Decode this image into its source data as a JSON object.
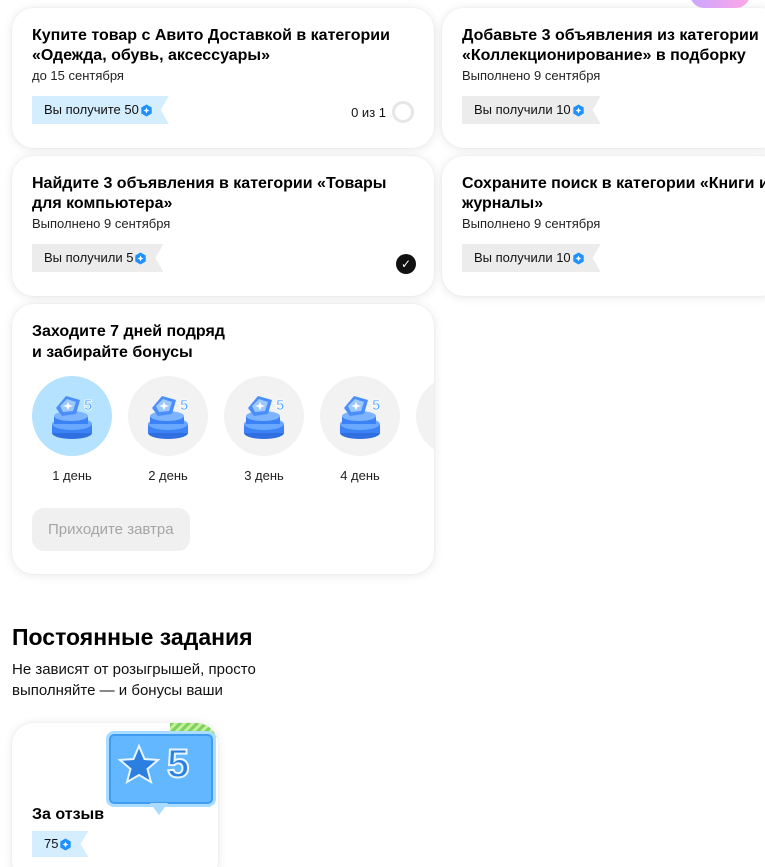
{
  "tasks": [
    {
      "title": "Купите товар с Авито Доставкой в категории «Одежда, обувь, аксессуары»",
      "subtitle": "до 15 сентября",
      "badge": "Вы получите 50",
      "progress": "0 из 1",
      "status": "in-progress"
    },
    {
      "title": "Добавьте 3 объявления из категории «Коллекционирование» в подборку",
      "subtitle": "Выполнено 9 сентября",
      "badge": "Вы получили 10",
      "status": "done"
    },
    {
      "title": "Найдите 3 объявления в категории «Товары для компьютера»",
      "subtitle": "Выполнено 9 сентября",
      "badge": "Вы получили 5",
      "status": "done"
    },
    {
      "title": "Сохраните поиск в категории «Книги и журналы»",
      "subtitle": "Выполнено 9 сентября",
      "badge": "Вы получили 10",
      "status": "done"
    }
  ],
  "streak": {
    "title_line1": "Заходите 7 дней подряд",
    "title_line2": "и забирайте бонусы",
    "days": [
      {
        "label": "1 день",
        "value": "5",
        "active": true
      },
      {
        "label": "2 день",
        "value": "5",
        "active": false
      },
      {
        "label": "3 день",
        "value": "5",
        "active": false
      },
      {
        "label": "4 день",
        "value": "5",
        "active": false
      }
    ],
    "button": "Приходите завтра"
  },
  "permanent": {
    "title": "Постоянные задания",
    "subtitle": "Не зависят от розыгрышей, просто выполняйте — и бонусы ваши",
    "cards": [
      {
        "title": "За отзыв",
        "reward": "75",
        "illustration_value": "5"
      }
    ]
  },
  "colors": {
    "badge_blue": "#d4eeff",
    "badge_gray": "#ececec",
    "coin": "#1e90ff",
    "active_day": "#b5e2ff"
  },
  "icons": {
    "coin": "bonus-coin-icon",
    "check": "check-icon",
    "stack": "coin-stack-icon",
    "review": "star-rating-icon"
  }
}
